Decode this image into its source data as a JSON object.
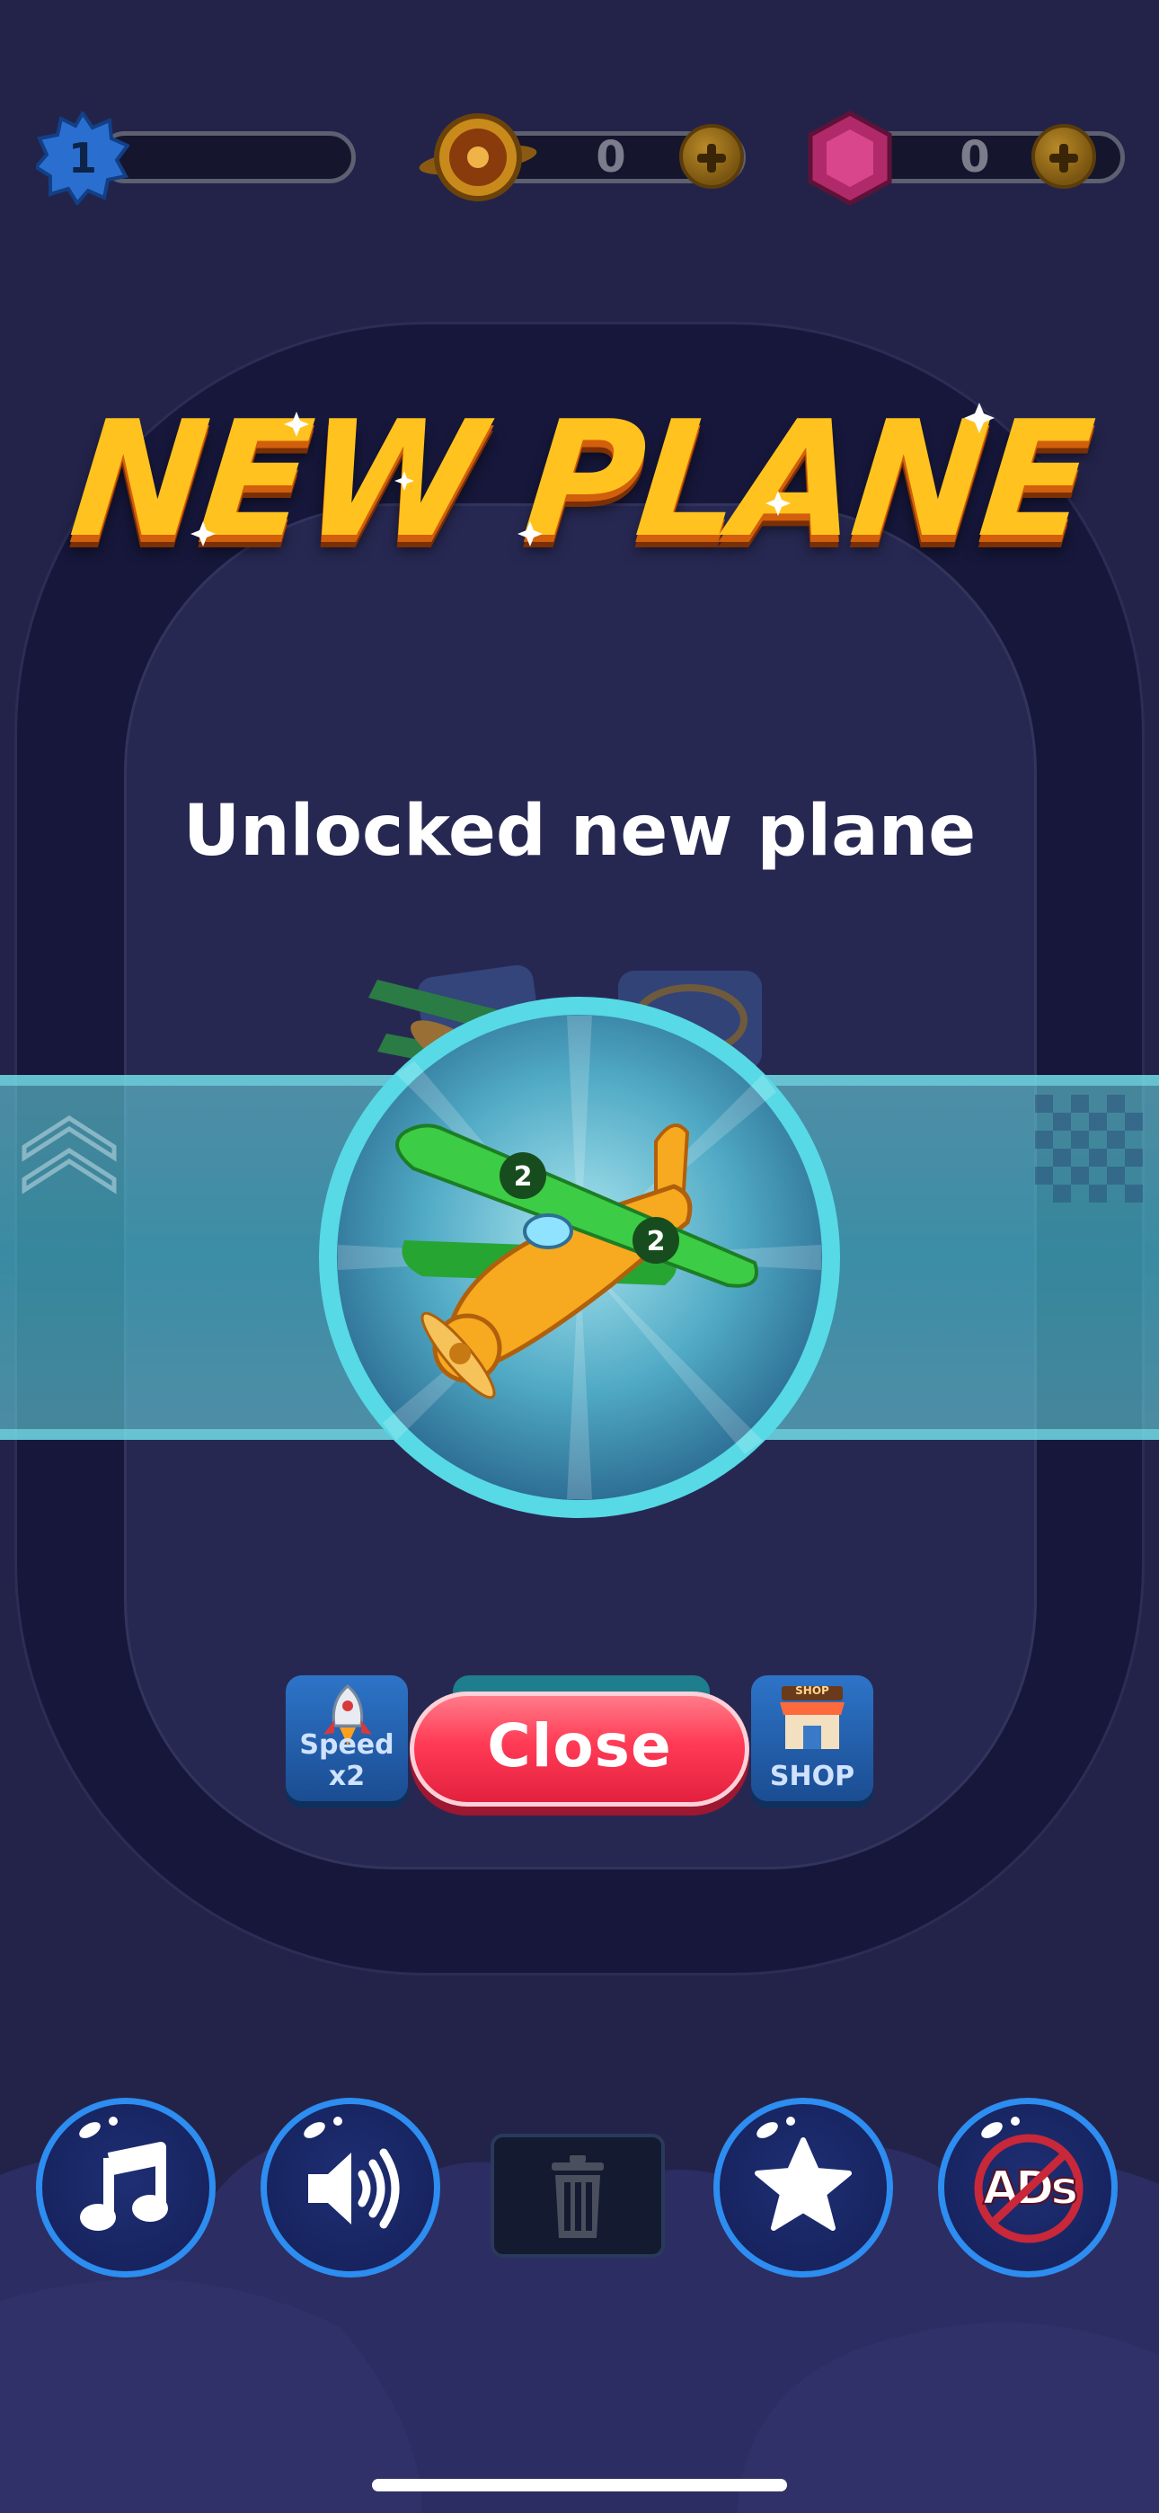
{
  "hud": {
    "level": "1",
    "coins": "0",
    "gems": "0"
  },
  "dialog": {
    "title": "NEW PLANE",
    "subtitle": "Unlocked new plane",
    "close_label": "Close",
    "plane_badge": "2"
  },
  "actions": {
    "speed_label": "Speed x2",
    "shop_label": "SHOP",
    "shop_sign": "SHOP"
  },
  "bottom_bar": {
    "ads_label": "ADs"
  },
  "colors": {
    "title": "#ffc21e",
    "close_button": "#ff3a55",
    "band": "#4ecad6",
    "plane_wing": "#2fbf3a",
    "plane_body": "#f7a91f"
  },
  "icons": [
    "star-badge-icon",
    "coin-icon",
    "gem-icon",
    "plus-icon",
    "music-icon",
    "sound-icon",
    "trash-icon",
    "star-icon",
    "no-ads-icon",
    "rocket-icon",
    "shop-icon",
    "chevron-up-icon",
    "checkered-flag-icon"
  ]
}
